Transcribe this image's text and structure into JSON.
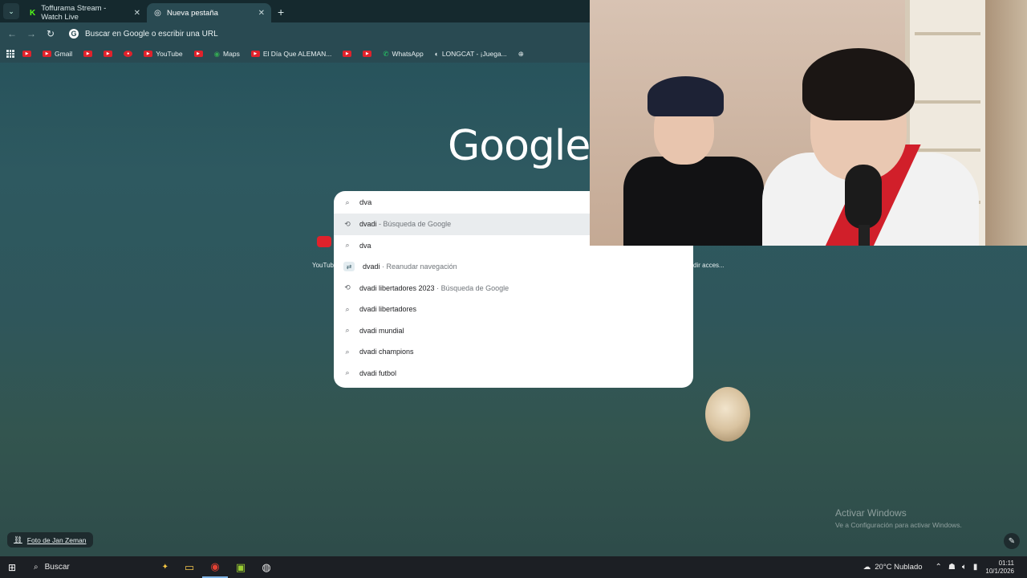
{
  "tabs": [
    {
      "label": "Toffurama Stream - Watch Live",
      "favicon": "kick-icon",
      "active": false
    },
    {
      "label": "Nueva pestaña",
      "favicon": "chrome-icon",
      "active": true
    }
  ],
  "toolbar": {
    "omnibox_placeholder": "Buscar en Google o escribir una URL"
  },
  "bookmarks": [
    {
      "label": "",
      "icon": "youtube-icon"
    },
    {
      "label": "Gmail",
      "icon": "youtube-icon"
    },
    {
      "label": "",
      "icon": "youtube-icon"
    },
    {
      "label": "",
      "icon": "youtube-icon"
    },
    {
      "label": "",
      "icon": "youtube-icon"
    },
    {
      "label": "YouTube",
      "icon": "youtube-icon"
    },
    {
      "label": "",
      "icon": "youtube-icon"
    },
    {
      "label": "Maps",
      "icon": "maps-icon"
    },
    {
      "label": "El Día Que ALEMAN...",
      "icon": "youtube-icon"
    },
    {
      "label": "",
      "icon": "youtube-icon"
    },
    {
      "label": "",
      "icon": "youtube-icon"
    },
    {
      "label": "WhatsApp",
      "icon": "whatsapp-icon"
    },
    {
      "label": "LONGCAT - ¡Juega...",
      "icon": "longcat-icon"
    }
  ],
  "logo": "Google",
  "search": {
    "query": "dva",
    "suggestions": [
      {
        "text": "dvadi",
        "sub": " - Búsqueda de Google",
        "icon": "history-icon",
        "highlighted": true
      },
      {
        "text": "dva",
        "sub": "",
        "icon": "search-icon",
        "highlighted": false
      },
      {
        "text": "dvadi",
        "sub": " · Reanudar navegación",
        "icon": "journey-icon",
        "highlighted": false
      },
      {
        "text": "dvadi libertadores 2023",
        "sub": " · Búsqueda de Google",
        "icon": "history-icon",
        "highlighted": false
      },
      {
        "text": "dvadi libertadores",
        "sub": "",
        "icon": "search-icon",
        "highlighted": false
      },
      {
        "text": "dvadi mundial",
        "sub": "",
        "icon": "search-icon",
        "highlighted": false
      },
      {
        "text": "dvadi champions",
        "sub": "",
        "icon": "search-icon",
        "highlighted": false
      },
      {
        "text": "dvadi futbol",
        "sub": "",
        "icon": "search-icon",
        "highlighted": false
      }
    ]
  },
  "shortcuts": {
    "left_label": "YouTub",
    "right_label": "dir acces..."
  },
  "background": {
    "credit": "Foto de Jan Zeman"
  },
  "watermark": {
    "title": "Activar Windows",
    "subtitle": "Ve a Configuración para activar Windows."
  },
  "taskbar": {
    "search_label": "Buscar",
    "weather": "20°C  Nublado",
    "time": "01:11",
    "date": "10/1/2026"
  }
}
